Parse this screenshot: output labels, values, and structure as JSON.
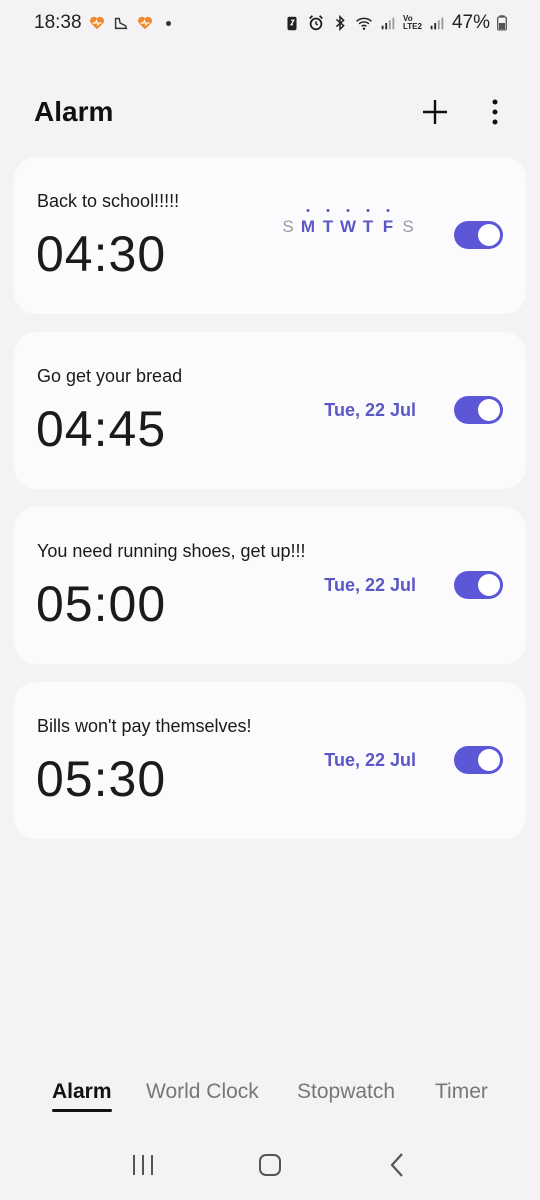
{
  "status_bar": {
    "time": "18:38",
    "battery": "47%",
    "icons": [
      "heart-icon",
      "shoe-icon",
      "heart-icon",
      "dot-icon",
      "battery-saver-icon",
      "alarm-icon",
      "bluetooth-icon",
      "wifi-icon",
      "signal-icon",
      "volte-icon",
      "signal-icon",
      "battery-icon"
    ],
    "volte_label_top": "Vo",
    "volte_label_bottom": "LTE2"
  },
  "header": {
    "title": "Alarm",
    "add_icon": "plus-icon",
    "more_icon": "more-vert-icon"
  },
  "alarms": [
    {
      "label": "Back to school!!!!!",
      "time": "04:30",
      "repeat": true,
      "days": [
        {
          "letter": "S",
          "active": false
        },
        {
          "letter": "M",
          "active": true
        },
        {
          "letter": "T",
          "active": true
        },
        {
          "letter": "W",
          "active": true
        },
        {
          "letter": "T",
          "active": true
        },
        {
          "letter": "F",
          "active": true
        },
        {
          "letter": "S",
          "active": false
        }
      ],
      "enabled": true
    },
    {
      "label": "Go get your bread",
      "time": "04:45",
      "date": "Tue, 22 Jul",
      "enabled": true
    },
    {
      "label": "You need running shoes, get up!!!",
      "time": "05:00",
      "date": "Tue, 22 Jul",
      "enabled": true
    },
    {
      "label": "Bills won't pay themselves!",
      "time": "05:30",
      "date": "Tue, 22 Jul",
      "enabled": true
    }
  ],
  "tabs": [
    {
      "label": "Alarm",
      "active": true
    },
    {
      "label": "World Clock",
      "active": false
    },
    {
      "label": "Stopwatch",
      "active": false
    },
    {
      "label": "Timer",
      "active": false
    }
  ],
  "colors": {
    "accent": "#5b57d6",
    "accent_text": "#5b57c4",
    "background": "#f3f3f6",
    "card": "#fbfbfd",
    "heart": "#f0892b"
  }
}
